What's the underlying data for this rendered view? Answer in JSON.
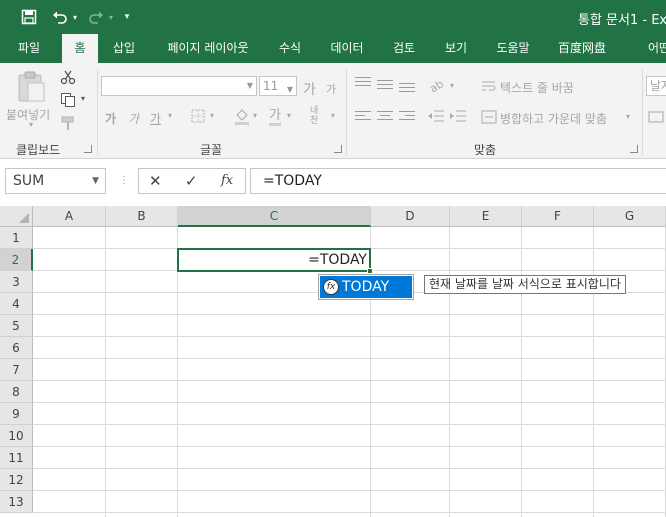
{
  "titlebar": {
    "title": "통합 문서1 - Ex",
    "icons": [
      "save-icon",
      "undo-icon",
      "redo-icon",
      "customize-qat-icon"
    ],
    "undo_arrow": "▾",
    "redo_arrow": "▾",
    "qat_arrow": "▾"
  },
  "tabs": [
    "파일",
    "홈",
    "삽입",
    "페이지 레이아웃",
    "수식",
    "데이터",
    "검토",
    "보기",
    "도움말",
    "百度网盘",
    "어떤"
  ],
  "ribbon": {
    "clipboard": {
      "paste_label": "붙여넣기",
      "group_label": "클립보드"
    },
    "font": {
      "font_name": "",
      "font_size": "11",
      "grow": "가",
      "shrink": "가",
      "bold": "가",
      "italic": "가",
      "underline": "가",
      "font_color": "가",
      "phonetic": "내천",
      "group_label": "글꼴"
    },
    "alignment": {
      "wrap_text": "텍스트 줄 바꿈",
      "merge_center": "병합하고 가운데 맞춤",
      "group_label": "맞춤"
    },
    "number": {
      "format_partial": "날자"
    }
  },
  "formula_bar": {
    "name_box": "SUM",
    "cancel_icon": "✕",
    "enter_icon": "✓",
    "fx_label": "fx",
    "formula": "=TODAY"
  },
  "grid": {
    "columns": [
      "A",
      "B",
      "C",
      "D",
      "E",
      "F",
      "G"
    ],
    "rows": [
      "1",
      "2",
      "3",
      "4",
      "5",
      "6",
      "7",
      "8",
      "9",
      "10",
      "11",
      "12",
      "13"
    ],
    "active_cell_text": "=TODAY",
    "autocomplete": {
      "item": "TODAY",
      "icon_label": "fx",
      "tooltip": "현재 날짜를 날짜 서식으로 표시합니다"
    }
  },
  "colors": {
    "accent": "#217346",
    "selection": "#0078d7"
  }
}
